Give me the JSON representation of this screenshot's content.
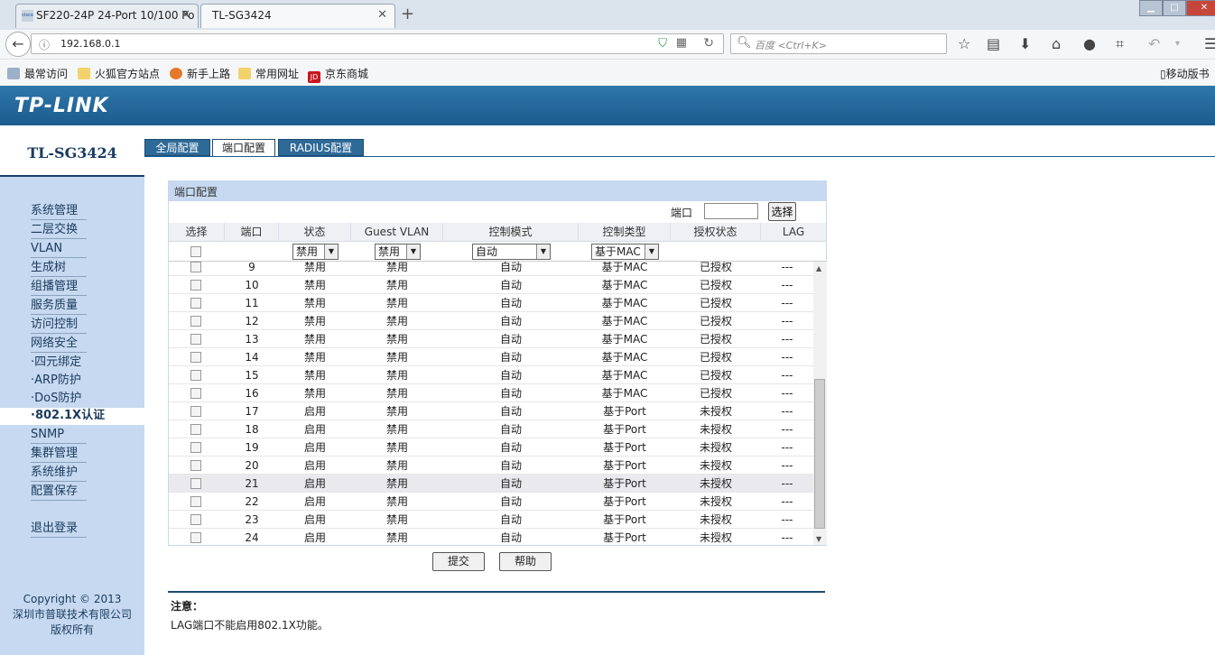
{
  "browser": {
    "tabs": [
      {
        "label": "SF220-24P 24-Port 10/100 Po",
        "active": false
      },
      {
        "label": "TL-SG3424",
        "active": true
      }
    ],
    "url": "192.168.0.1",
    "search_placeholder": "百度 <Ctrl+K>",
    "bookmarks": [
      "最常访问",
      "火狐官方站点",
      "新手上路",
      "常用网址",
      "京东商城"
    ],
    "mobile_bookmarks": "移动版书"
  },
  "header": {
    "logo": "TP-LINK",
    "model": "TL-SG3424"
  },
  "config_tabs": [
    {
      "label": "全局配置",
      "active": false
    },
    {
      "label": "端口配置",
      "active": true
    },
    {
      "label": "RADIUS配置",
      "active": false
    }
  ],
  "sidebar": {
    "items": [
      {
        "label": "系统管理",
        "type": "menu"
      },
      {
        "label": "二层交换",
        "type": "menu"
      },
      {
        "label": "VLAN",
        "type": "menu"
      },
      {
        "label": "生成树",
        "type": "menu"
      },
      {
        "label": "组播管理",
        "type": "menu"
      },
      {
        "label": "服务质量",
        "type": "menu"
      },
      {
        "label": "访问控制",
        "type": "menu"
      },
      {
        "label": "网络安全",
        "type": "menu"
      },
      {
        "label": "·四元绑定",
        "type": "sub"
      },
      {
        "label": "·ARP防护",
        "type": "sub"
      },
      {
        "label": "·DoS防护",
        "type": "sub"
      },
      {
        "label": "·802.1X认证",
        "type": "active"
      },
      {
        "label": "SNMP",
        "type": "menu"
      },
      {
        "label": "集群管理",
        "type": "menu"
      },
      {
        "label": "系统维护",
        "type": "menu"
      },
      {
        "label": "配置保存",
        "type": "menu"
      },
      {
        "label": "退出登录",
        "type": "menu"
      }
    ],
    "copyright": [
      "Copyright © 2013",
      "深圳市普联技术有限公司",
      "版权所有"
    ]
  },
  "panel": {
    "title": "端口配置",
    "port_label": "端口",
    "port_value": "",
    "select_button": "选择",
    "columns": [
      "选择",
      "端口",
      "状态",
      "Guest VLAN",
      "控制模式",
      "控制类型",
      "授权状态",
      "LAG"
    ],
    "bulk": {
      "status": "禁用",
      "guest_vlan": "禁用",
      "mode": "自动",
      "type": "基于MAC"
    },
    "rows": [
      {
        "port": "9",
        "status": "禁用",
        "guest_vlan": "禁用",
        "mode": "自动",
        "type": "基于MAC",
        "auth": "已授权",
        "lag": "---"
      },
      {
        "port": "10",
        "status": "禁用",
        "guest_vlan": "禁用",
        "mode": "自动",
        "type": "基于MAC",
        "auth": "已授权",
        "lag": "---"
      },
      {
        "port": "11",
        "status": "禁用",
        "guest_vlan": "禁用",
        "mode": "自动",
        "type": "基于MAC",
        "auth": "已授权",
        "lag": "---"
      },
      {
        "port": "12",
        "status": "禁用",
        "guest_vlan": "禁用",
        "mode": "自动",
        "type": "基于MAC",
        "auth": "已授权",
        "lag": "---"
      },
      {
        "port": "13",
        "status": "禁用",
        "guest_vlan": "禁用",
        "mode": "自动",
        "type": "基于MAC",
        "auth": "已授权",
        "lag": "---"
      },
      {
        "port": "14",
        "status": "禁用",
        "guest_vlan": "禁用",
        "mode": "自动",
        "type": "基于MAC",
        "auth": "已授权",
        "lag": "---"
      },
      {
        "port": "15",
        "status": "禁用",
        "guest_vlan": "禁用",
        "mode": "自动",
        "type": "基于MAC",
        "auth": "已授权",
        "lag": "---"
      },
      {
        "port": "16",
        "status": "禁用",
        "guest_vlan": "禁用",
        "mode": "自动",
        "type": "基于MAC",
        "auth": "已授权",
        "lag": "---"
      },
      {
        "port": "17",
        "status": "启用",
        "guest_vlan": "禁用",
        "mode": "自动",
        "type": "基于Port",
        "auth": "未授权",
        "lag": "---"
      },
      {
        "port": "18",
        "status": "启用",
        "guest_vlan": "禁用",
        "mode": "自动",
        "type": "基于Port",
        "auth": "未授权",
        "lag": "---"
      },
      {
        "port": "19",
        "status": "启用",
        "guest_vlan": "禁用",
        "mode": "自动",
        "type": "基于Port",
        "auth": "未授权",
        "lag": "---"
      },
      {
        "port": "20",
        "status": "启用",
        "guest_vlan": "禁用",
        "mode": "自动",
        "type": "基于Port",
        "auth": "未授权",
        "lag": "---"
      },
      {
        "port": "21",
        "status": "启用",
        "guest_vlan": "禁用",
        "mode": "自动",
        "type": "基于Port",
        "auth": "未授权",
        "lag": "---"
      },
      {
        "port": "22",
        "status": "启用",
        "guest_vlan": "禁用",
        "mode": "自动",
        "type": "基于Port",
        "auth": "未授权",
        "lag": "---"
      },
      {
        "port": "23",
        "status": "启用",
        "guest_vlan": "禁用",
        "mode": "自动",
        "type": "基于Port",
        "auth": "未授权",
        "lag": "---"
      },
      {
        "port": "24",
        "status": "启用",
        "guest_vlan": "禁用",
        "mode": "自动",
        "type": "基于Port",
        "auth": "未授权",
        "lag": "---"
      }
    ],
    "submit_button": "提交",
    "help_button": "帮助"
  },
  "note": {
    "title": "注意：",
    "text": "LAG端口不能启用802.1X功能。"
  }
}
